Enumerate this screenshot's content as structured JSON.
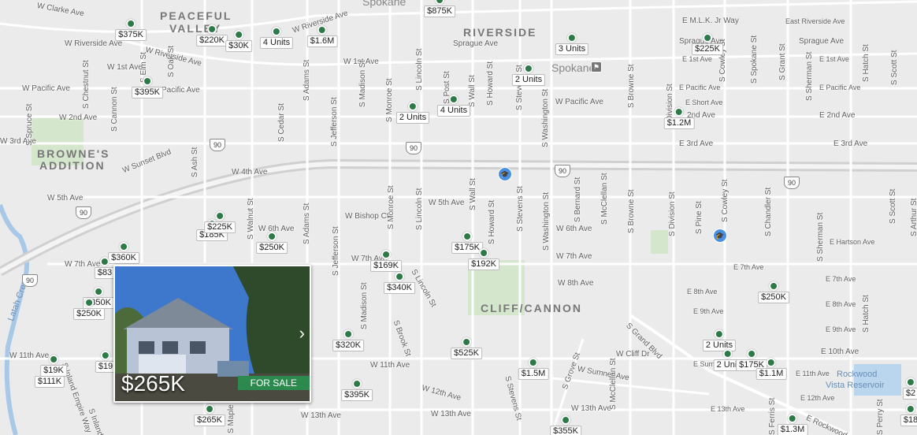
{
  "map": {
    "neighborhoods": [
      "PEACEFUL",
      "VALLEY",
      "RIVERSIDE",
      "BROWNE'S",
      "ADDITION",
      "CLIFF/CANNON"
    ],
    "city_labels": [
      "Spokane",
      "Spokane"
    ],
    "water_labels": [
      "Latah Creek",
      "Rockwood",
      "Vista Reservoir"
    ],
    "highway": "90",
    "streets": [
      "W Clarke Ave",
      "W Riverside Ave",
      "W Riverside Ave",
      "W Riverside Ave",
      "W 1st Ave",
      "W 1st Ave",
      "W Pacific Ave",
      "W Pacific Ave",
      "Pacific Ave",
      "W 2nd Ave",
      "W 3rd Ave",
      "W Sunset Blvd",
      "W 4th Ave",
      "W 5th Ave",
      "W 5th Ave",
      "W 6th Ave",
      "W 6th Ave",
      "W 7th Ave",
      "W 7th Ave",
      "W 7th Ave",
      "W 8th Ave",
      "W Bishop Ct",
      "W 11th Ave",
      "W 11th Ave",
      "W 12th Ave",
      "W 13th Ave",
      "W 13th Ave",
      "W 13th Ave",
      "W Sumner Ave",
      "W Cliff Dr",
      "Sprague Ave",
      "Sprague Ave",
      "Sprague Ave",
      "E M.L.K. Jr Way",
      "East Riverside Ave",
      "E 1st Ave",
      "E 1st Ave",
      "E Pacific Ave",
      "E Pacific Ave",
      "E Short Ave",
      "E 2nd Ave",
      "2nd Ave",
      "E 3rd Ave",
      "E 3rd Ave",
      "E Hartson Ave",
      "E 7th Ave",
      "E 7th Ave",
      "E 8th Ave",
      "E 8th Ave",
      "E 9th Ave",
      "E 9th Ave",
      "E 10th Ave",
      "E 11th Ave",
      "E 12th Ave",
      "E 13th Ave",
      "E Sumner Ave",
      "E Rockwood",
      "S Grand Blvd",
      "S Division St",
      "S Division St",
      "S Browne St",
      "S Browne St",
      "S Washington St",
      "S Washington St",
      "S Stevens St",
      "S Stevens St",
      "S Howard St",
      "S Howard St",
      "S Wall St",
      "S Wall St",
      "S Post St",
      "S Lincoln St",
      "S Lincoln St",
      "S Lincoln St",
      "S Monroe St",
      "S Monroe St",
      "S Madison St",
      "S Madison St",
      "S Jefferson St",
      "S Jefferson St",
      "S Adams St",
      "S Adams St",
      "S Cedar St",
      "S Walnut St",
      "S Maple St",
      "S Ash St",
      "S Elm St",
      "S Oak St",
      "S Chestnut St",
      "S Cannon St",
      "S Spruce St",
      "S Inland Empire Way",
      "S Inland",
      "S Brook St",
      "S Bernard St",
      "S McClellan St",
      "S McClellan St",
      "S Pine St",
      "S Cowley St",
      "S Cowley St",
      "S Sherman St",
      "S Sherman St",
      "S Spokane St",
      "S Grant St",
      "S Hatch St",
      "S Hatch St",
      "S Scott St",
      "S Scott St",
      "S Chandler St",
      "S Grove St",
      "S Perry St",
      "S Ferris St",
      "S Stevens St",
      "S Arthur St"
    ],
    "markers": [
      "$875K",
      "$375K",
      "$220K",
      "$30K",
      "4 Units",
      "$1.6M",
      "3 Units",
      "$225K",
      "2 Units",
      "$395K",
      "2 Units",
      "4 Units",
      "$1.2M",
      "$185K",
      "$225K",
      "$250K",
      "$360K",
      "$83",
      "$350K",
      "$250K",
      "$169K",
      "$340K",
      "$175K",
      "$192K",
      "$250K",
      "$320K",
      "$525K",
      "$1.5M",
      "2 Units",
      "2 Unit",
      "$175K",
      "$1.1M",
      "$395K",
      "$265K",
      "$355K",
      "$1.3M",
      "$19",
      "$111K",
      "$19K",
      "$2",
      "$18"
    ]
  },
  "listing_card": {
    "price": "$265K",
    "status": "FOR SALE",
    "next_icon": "chevron-right-icon"
  },
  "colors": {
    "marker": "#2d7a47",
    "badge": "#2d8a4e",
    "water": "#a8c8e8",
    "park": "#cfe3c8",
    "poi": "#4a90e2"
  }
}
